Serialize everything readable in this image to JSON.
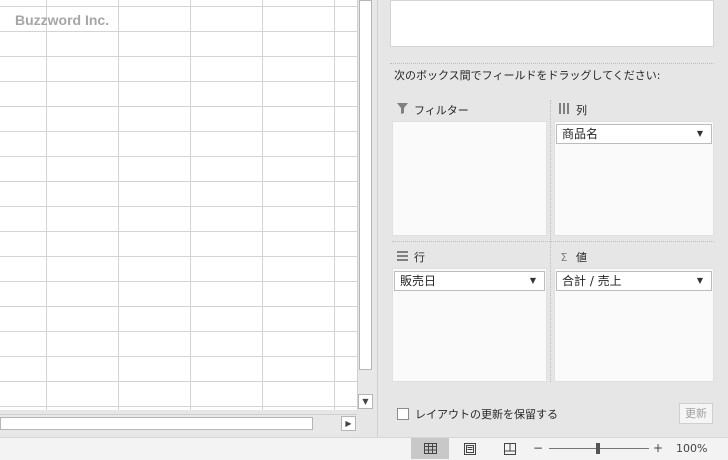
{
  "spreadsheet": {
    "watermark": "Buzzword Inc."
  },
  "pivot_pane": {
    "drag_instruction": "次のボックス間でフィールドをドラッグしてください:",
    "areas": {
      "filters": {
        "label": "フィルター",
        "icon": "filter-icon",
        "items": []
      },
      "columns": {
        "label": "列",
        "icon": "columns-icon",
        "items": [
          "商品名"
        ]
      },
      "rows": {
        "label": "行",
        "icon": "rows-icon",
        "items": [
          "販売日"
        ]
      },
      "values": {
        "label": "値",
        "icon": "sigma-icon",
        "items": [
          "合計 / 売上"
        ]
      }
    },
    "defer_update": {
      "label": "レイアウトの更新を保留する",
      "checked": false
    },
    "update_button": "更新"
  },
  "statusbar": {
    "zoom_level": "100%",
    "zoom_minus": "−",
    "zoom_plus": "+",
    "active_view": "normal"
  }
}
